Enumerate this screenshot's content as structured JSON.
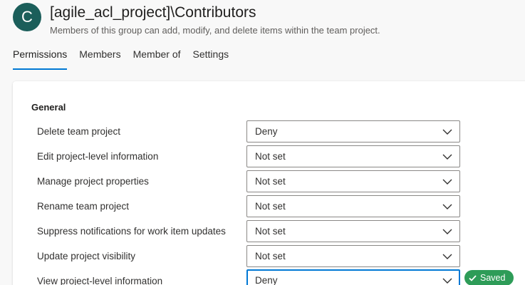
{
  "header": {
    "avatar_letter": "C",
    "title": "[agile_acl_project]\\Contributors",
    "subtitle": "Members of this group can add, modify, and delete items within the team project."
  },
  "tabs": [
    {
      "label": "Permissions",
      "active": true
    },
    {
      "label": "Members",
      "active": false
    },
    {
      "label": "Member of",
      "active": false
    },
    {
      "label": "Settings",
      "active": false
    }
  ],
  "section": {
    "title": "General",
    "permissions": [
      {
        "label": "Delete team project",
        "value": "Deny"
      },
      {
        "label": "Edit project-level information",
        "value": "Not set"
      },
      {
        "label": "Manage project properties",
        "value": "Not set"
      },
      {
        "label": "Rename team project",
        "value": "Not set"
      },
      {
        "label": "Suppress notifications for work item updates",
        "value": "Not set"
      },
      {
        "label": "Update project visibility",
        "value": "Not set"
      },
      {
        "label": "View project-level information",
        "value": "Deny"
      }
    ]
  },
  "status": {
    "saved_label": "Saved",
    "color": "#2e9c58"
  },
  "colors": {
    "accent": "#0078d4",
    "avatar": "#1b5e5a"
  }
}
